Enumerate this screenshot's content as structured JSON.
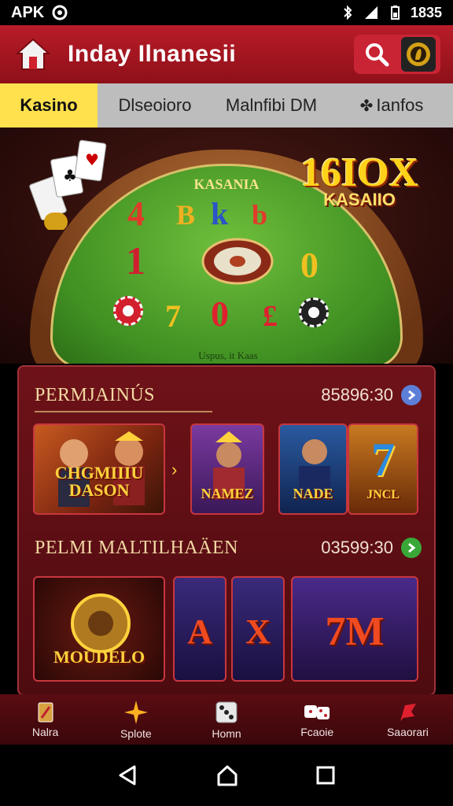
{
  "status_bar": {
    "carrier": "APK",
    "time": "1835"
  },
  "header": {
    "title": "Inday Ilnanesii"
  },
  "tabs": [
    {
      "label": "Kasino",
      "active": true
    },
    {
      "label": "Dlseoioro",
      "active": false
    },
    {
      "label": "Malnfibi  DM",
      "active": false
    },
    {
      "label": "Ianfos",
      "active": false
    }
  ],
  "hero": {
    "table_title": "KASANIA",
    "badge_big": "16IOX",
    "badge_small": "KASAIIO",
    "table_footer": "Uspus, it Kaas",
    "felt_numbers": [
      "4",
      "B",
      "k",
      "b",
      "1",
      "0",
      "7",
      "0",
      "£"
    ]
  },
  "section1": {
    "title": "PERMJAINÚS",
    "count": "85896:30",
    "games": [
      {
        "label": "CHGMIIIU\nDASON"
      },
      {
        "label": "NAMEZ"
      },
      {
        "label": "NADE"
      },
      {
        "label": "JNCL"
      }
    ]
  },
  "section2": {
    "title": "PELMI MALTILHAÄEN",
    "count": "03599:30",
    "games": [
      {
        "label": "MOUDELO"
      },
      {
        "label": "A"
      },
      {
        "label": "X"
      },
      {
        "label": "7M"
      }
    ]
  },
  "bottom_nav": [
    {
      "label": "Nalra",
      "icon": "card-icon"
    },
    {
      "label": "Splote",
      "icon": "sparkle-icon"
    },
    {
      "label": "Homn",
      "icon": "dice-icon"
    },
    {
      "label": "Fcaoie",
      "icon": "dice-pair-icon"
    },
    {
      "label": "Saaorari",
      "icon": "flag-icon"
    }
  ],
  "colors": {
    "brand_red": "#b91c28",
    "tab_active": "#ffe14d",
    "panel": "#5e0e14",
    "gold": "#ffd23c"
  }
}
